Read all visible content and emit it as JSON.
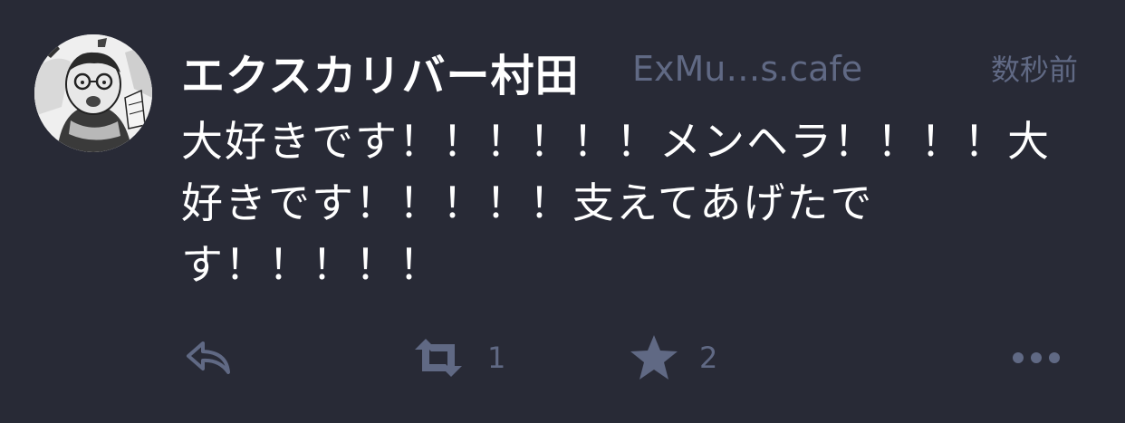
{
  "status": {
    "display_name": "エクスカリバー村田",
    "acct": "ExMu…s.cafe",
    "timestamp": "数秒前",
    "content": "大好きです！！！！！！メンヘラ！！！！大好きです！！！！！支えてあげたです！！！！！",
    "avatar_icon": "user-avatar",
    "actions": {
      "reply_icon": "reply-icon",
      "boost_icon": "boost-icon",
      "boost_count": "1",
      "favourite_icon": "star-icon",
      "favourite_count": "2",
      "more_icon": "ellipsis-icon"
    }
  },
  "colors": {
    "background": "#282a36",
    "text": "#ffffff",
    "muted": "#606984"
  }
}
